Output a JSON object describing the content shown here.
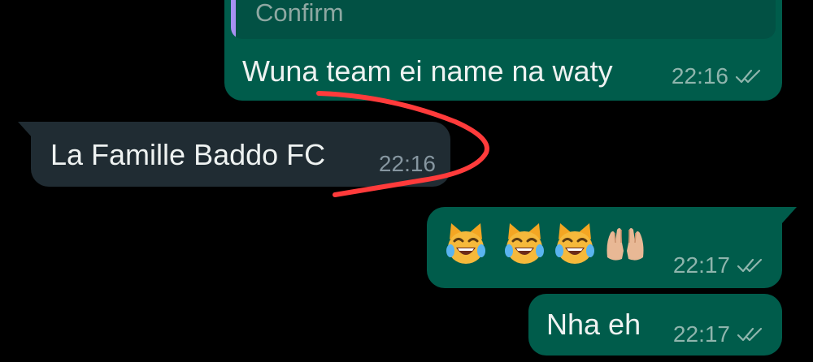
{
  "conversation": {
    "messages": [
      {
        "id": "m1",
        "direction": "outgoing",
        "quote": "Confirm",
        "text": "Wuna team ei name na waty",
        "time": "22:16",
        "status": "read"
      },
      {
        "id": "m2",
        "direction": "incoming",
        "text": "La Famille Baddo FC",
        "time": "22:16"
      },
      {
        "id": "m3",
        "direction": "outgoing",
        "emojis": [
          "cat-tears-of-joy-icon",
          "cat-tears-of-joy-icon",
          "cat-tears-of-joy-icon",
          "open-hands-icon"
        ],
        "time": "22:17",
        "status": "read"
      },
      {
        "id": "m4",
        "direction": "outgoing",
        "text": "Nha eh",
        "time": "22:17",
        "status": "read"
      }
    ]
  },
  "colors": {
    "background": "#000000",
    "outgoing_bubble": "#005c4b",
    "incoming_bubble": "#202c33",
    "quote_accent": "#a791f2",
    "annotation_stroke": "#ff3b3b"
  }
}
